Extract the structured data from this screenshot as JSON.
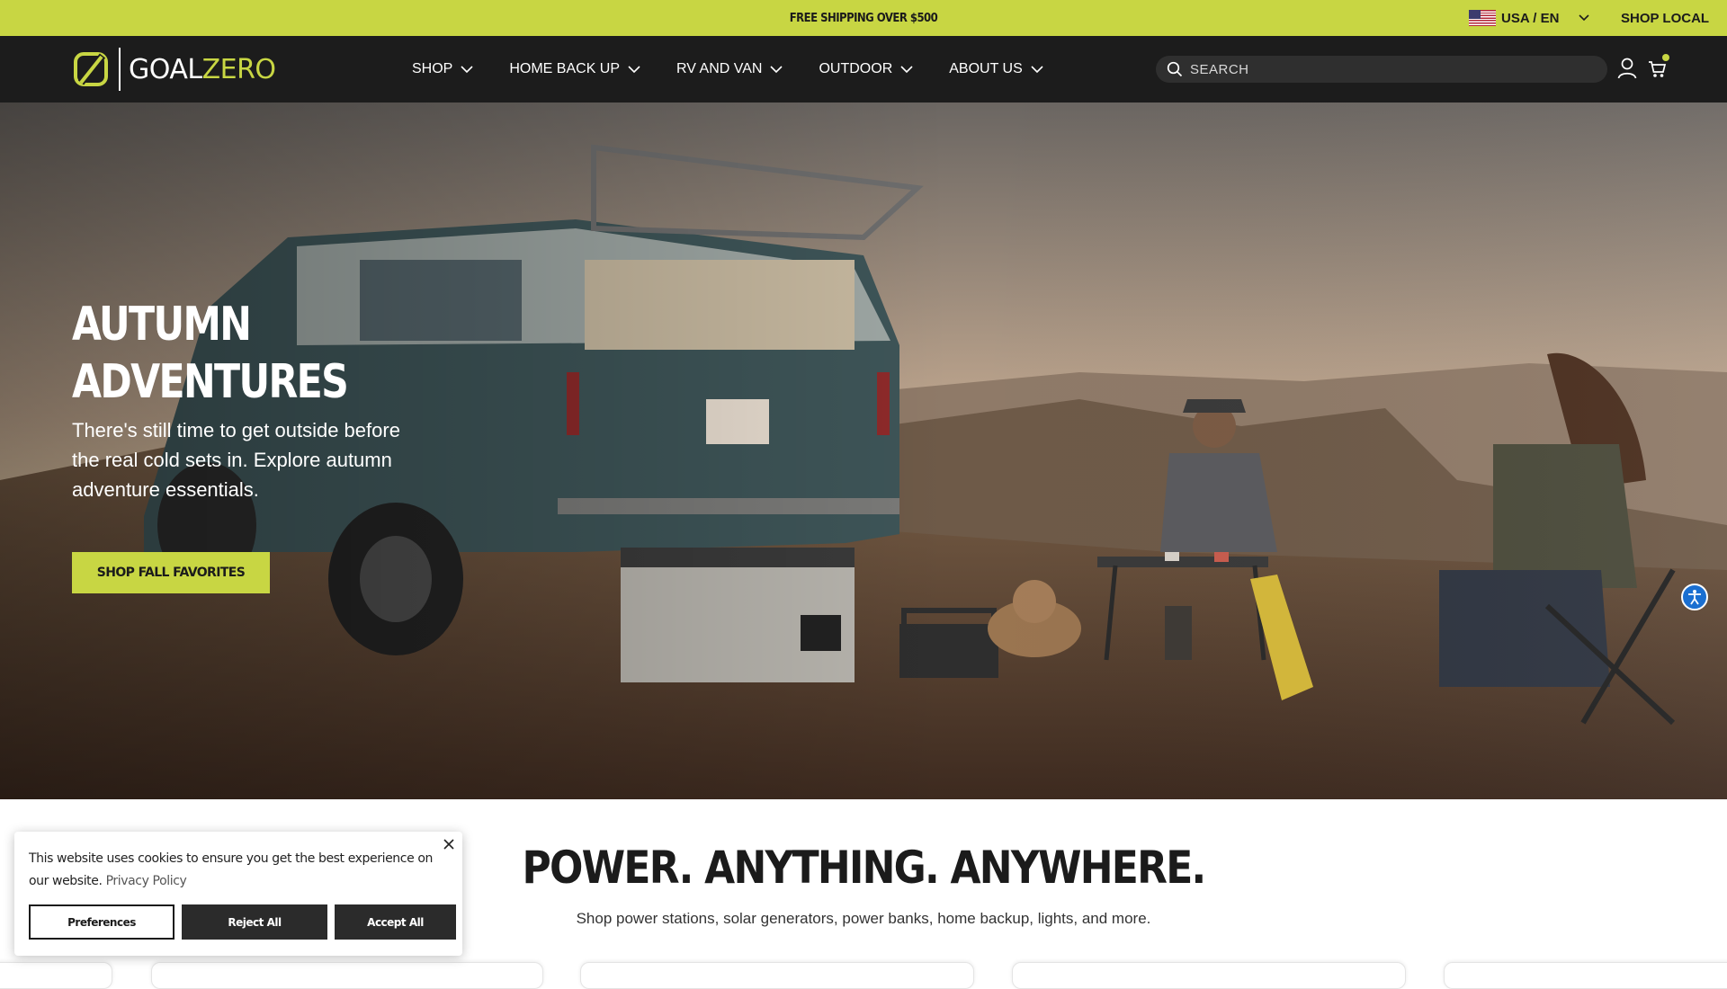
{
  "announcement": {
    "promo": "FREE SHIPPING OVER $500",
    "locale": "USA / EN",
    "shop_local": "SHOP LOCAL"
  },
  "header": {
    "logo_text_goal": "GOAL",
    "logo_text_zero": "ZERO",
    "nav": [
      {
        "label": "SHOP"
      },
      {
        "label": "HOME BACK UP"
      },
      {
        "label": "RV AND VAN"
      },
      {
        "label": "OUTDOOR"
      },
      {
        "label": "ABOUT US"
      }
    ],
    "search_placeholder": "SEARCH",
    "icons": [
      "search-icon",
      "account-icon",
      "cart-icon",
      "chevron-down-icon"
    ]
  },
  "hero": {
    "title_line1": "AUTUMN",
    "title_line2": "ADVENTURES",
    "text": "There's still time to get outside before the real cold sets in. Explore autumn adventure essentials.",
    "cta": "SHOP FALL FAVORITES"
  },
  "intro": {
    "tagline": "POWER. ANYTHING. ANYWHERE.",
    "subline": "Shop power stations, solar generators, power banks, home backup, lights, and more."
  },
  "cookie": {
    "message": "This website uses cookies to ensure you get the best experience on our website.",
    "link": "Privacy Policy",
    "preferences": "Preferences",
    "reject": "Reject All",
    "accept": "Accept All"
  },
  "colors": {
    "brand_lime": "#c8d643",
    "header_bg": "#1c1c1c",
    "accessibility_blue": "#1a6fd1"
  }
}
